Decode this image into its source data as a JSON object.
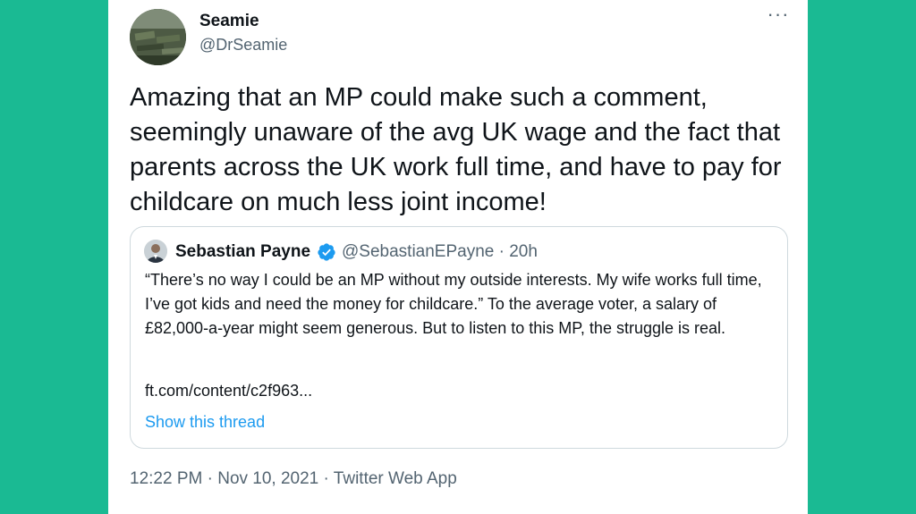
{
  "tweet": {
    "display_name": "Seamie",
    "handle": "@DrSeamie",
    "text": "Amazing that an MP could make such a comment, seemingly unaware of the avg UK wage and the fact that parents across the UK work full time, and have to pay for childcare on much less joint income!",
    "more_icon": "more-horizontal-icon",
    "more_glyph": "···"
  },
  "quoted": {
    "display_name": "Sebastian Payne",
    "verified_icon": "verified-badge-icon",
    "handle_time": "@SebastianEPayne · 20h",
    "text": "“There’s no way I could be an MP without my outside interests. My wife works full time, I’ve got kids and need the money for childcare.” To the average voter, a salary of £82,000-a-year might seem generous. But to listen to this MP, the struggle is real.",
    "link": "ft.com/content/c2f963...",
    "show_thread": "Show this thread"
  },
  "footer": {
    "time": "12:22 PM",
    "separator1": " · ",
    "date": "Nov 10, 2021",
    "separator2": " · ",
    "source": "Twitter Web App"
  },
  "colors": {
    "background": "#1aba93",
    "card": "#ffffff",
    "text_primary": "#0f1419",
    "text_secondary": "#536471",
    "link_blue": "#1d9bf0",
    "border": "#cfd9de"
  }
}
